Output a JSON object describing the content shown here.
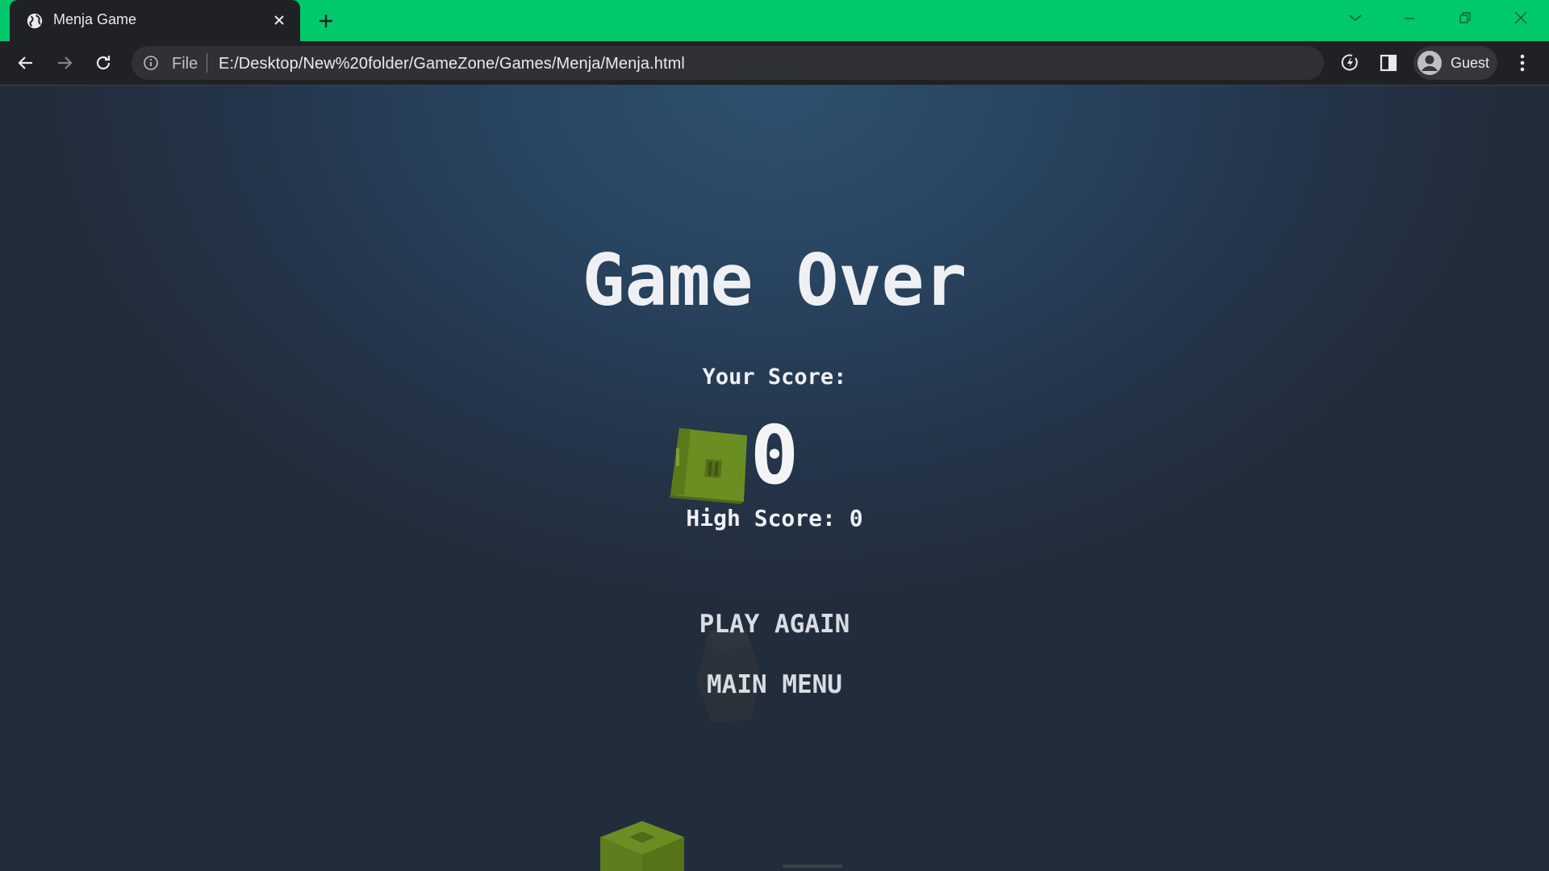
{
  "browser": {
    "tab_title": "Menja Game",
    "file_label": "File",
    "url": "E:/Desktop/New%20folder/GameZone/Games/Menja/Menja.html",
    "profile_label": "Guest",
    "accent_color": "#00c96b"
  },
  "game": {
    "title": "Game Over",
    "score_label": "Your Score:",
    "score": "0",
    "high_score_text": "High Score: 0",
    "buttons": {
      "play_again": "PLAY AGAIN",
      "main_menu": "MAIN MENU"
    },
    "cube_color": "#6b8e23"
  }
}
